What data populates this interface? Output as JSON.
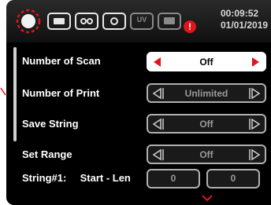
{
  "status_bar": {
    "time": "00:09:52",
    "date": "01/01/2019",
    "uv_label": "UV",
    "alert_mark": "!"
  },
  "settings": {
    "rows": [
      {
        "label": "Number of Scan",
        "value": "Off"
      },
      {
        "label": "Number of Print",
        "value": "Unlimited"
      },
      {
        "label": "Save String",
        "value": "Off"
      },
      {
        "label": "Set Range",
        "value": "Off"
      }
    ],
    "string_row": {
      "label": "String#1:",
      "sublabel": "Start - Len",
      "start": "0",
      "length": "0"
    }
  },
  "colors": {
    "accent": "#e0141b",
    "background": "#000000",
    "text": "#ffffff",
    "inactive_value": "#9a9a9a"
  }
}
